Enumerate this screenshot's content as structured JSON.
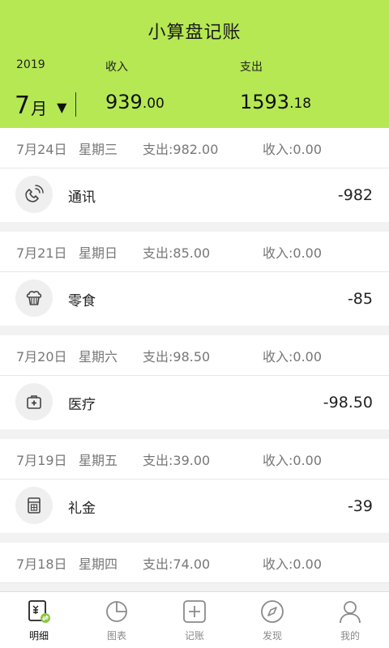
{
  "header": {
    "title": "小算盘记账",
    "year_label": "2019",
    "income_label": "收入",
    "expense_label": "支出",
    "month_number": "7",
    "month_unit": "月",
    "month_caret": "▼",
    "income_int": "939",
    "income_dec": ".00",
    "expense_int": "1593",
    "expense_dec": ".18"
  },
  "groups": [
    {
      "date": "7月24日",
      "weekday": "星期三",
      "expense": "支出:982.00",
      "income": "收入:0.00",
      "items": [
        {
          "name": "通讯",
          "amount": "-982",
          "icon": "phone-icon"
        }
      ]
    },
    {
      "date": "7月21日",
      "weekday": "星期日",
      "expense": "支出:85.00",
      "income": "收入:0.00",
      "items": [
        {
          "name": "零食",
          "amount": "-85",
          "icon": "cupcake-icon"
        }
      ]
    },
    {
      "date": "7月20日",
      "weekday": "星期六",
      "expense": "支出:98.50",
      "income": "收入:0.00",
      "items": [
        {
          "name": "医疗",
          "amount": "-98.50",
          "icon": "medical-kit-icon"
        }
      ]
    },
    {
      "date": "7月19日",
      "weekday": "星期五",
      "expense": "支出:39.00",
      "income": "收入:0.00",
      "items": [
        {
          "name": "礼金",
          "amount": "-39",
          "icon": "red-envelope-icon"
        }
      ]
    },
    {
      "date": "7月18日",
      "weekday": "星期四",
      "expense": "支出:74.00",
      "income": "收入:0.00",
      "items": []
    }
  ],
  "tabs": [
    {
      "label": "明细",
      "icon": "ledger-icon",
      "active": true
    },
    {
      "label": "图表",
      "icon": "pie-chart-icon",
      "active": false
    },
    {
      "label": "记账",
      "icon": "add-icon",
      "active": false
    },
    {
      "label": "发现",
      "icon": "compass-icon",
      "active": false
    },
    {
      "label": "我的",
      "icon": "user-icon",
      "active": false
    }
  ],
  "colors": {
    "header_bg": "#b5e853",
    "active_tab_accent": "#8cc63f"
  }
}
